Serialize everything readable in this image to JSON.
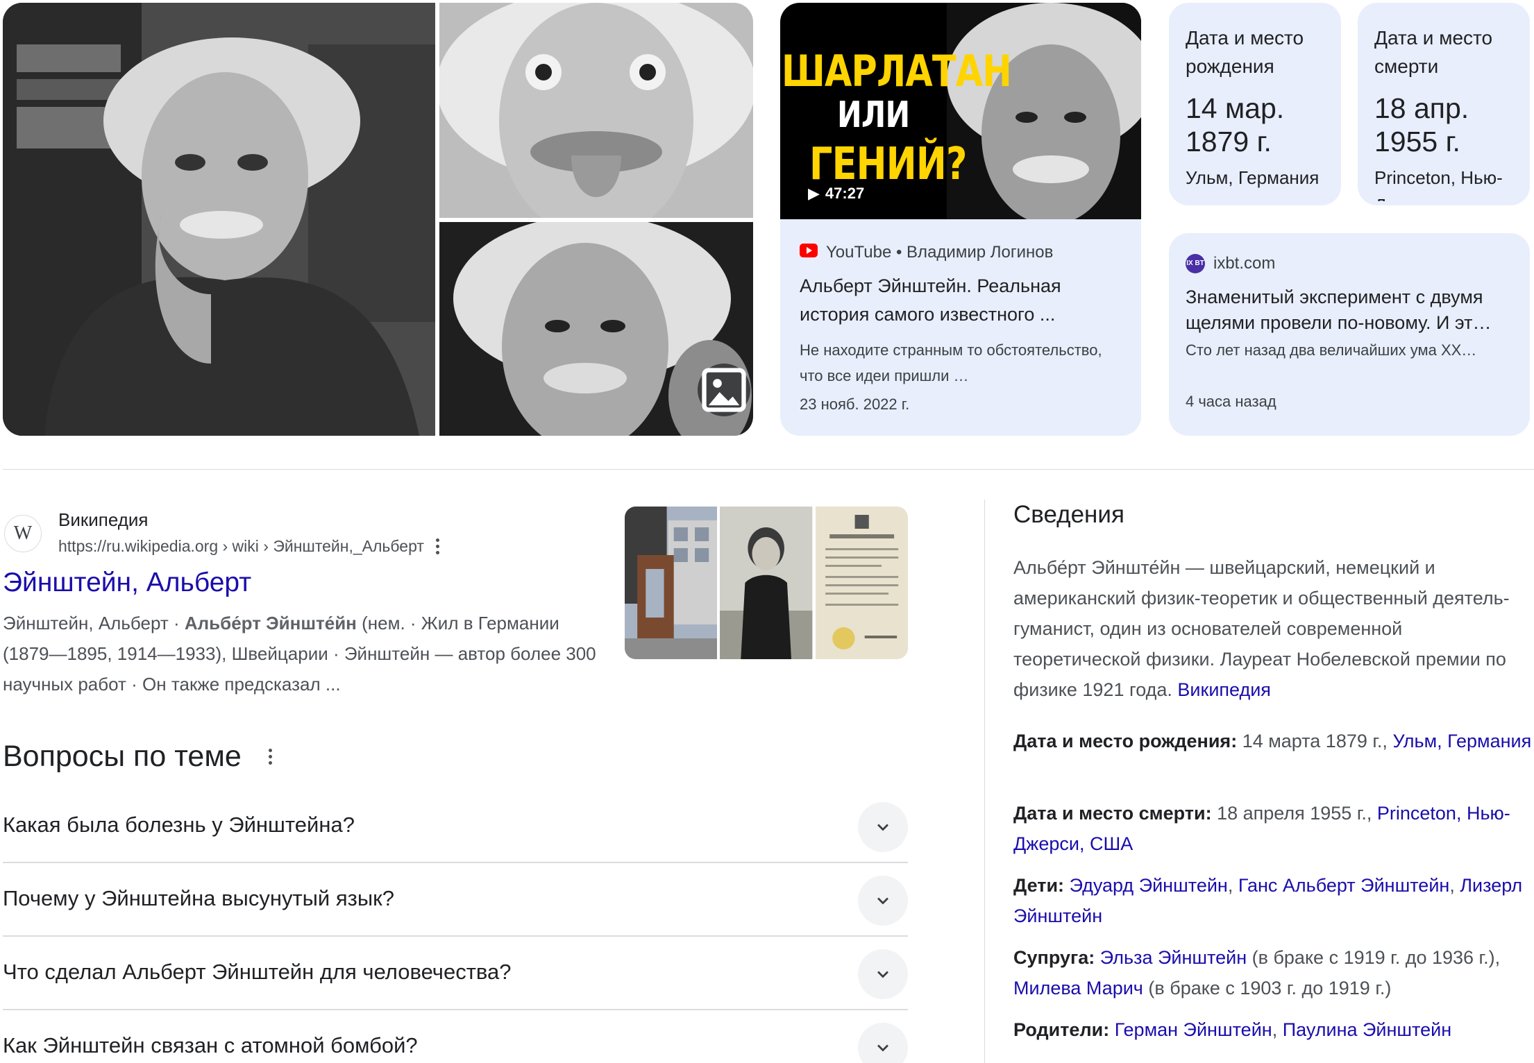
{
  "video": {
    "thumb_line1": "ШАРЛАТАН",
    "thumb_line2": "ИЛИ",
    "thumb_line3": "ГЕНИЙ?",
    "duration": "47:27",
    "source": "YouTube • Владимир Логинов",
    "title": "Альберт Эйнштейн. Реальная история самого известного ...",
    "snippet": "Не находите странным то обстоятельство, что все идеи пришли …",
    "date": "23 нояб. 2022 г."
  },
  "birth_tile": {
    "label": "Дата и место рождения",
    "value": "14 мар. 1879 г.",
    "place": "Ульм, Германия"
  },
  "death_tile": {
    "label": "Дата и место смерти",
    "value": "18 апр. 1955 г.",
    "place": "Princeton, Нью-Джерси"
  },
  "news": {
    "favicon_text": "IX BT",
    "source": "ixbt.com",
    "title": "Знаменитый эксперимент с двумя щелями провели по-новому. И эт…",
    "snippet": "Сто лет назад два величайших ума XX…",
    "date": "4 часа назад"
  },
  "wiki": {
    "favicon": "W",
    "site": "Википедия",
    "url": "https://ru.wikipedia.org › wiki › Эйнштейн,_Альберт",
    "title": "Эйнштейн, Альберт",
    "snippet_1": "Эйнштейн, Альберт · ",
    "snippet_bold": "Альбе́рт Эйнште́йн",
    "snippet_2": " (нем. · Жил в Германии (1879—1895, 1914—1933), Швейцарии · Эйнштейн — автор более 300 научных работ · Он также предсказал ..."
  },
  "paa": {
    "heading": "Вопросы по теме",
    "questions": [
      "Какая была болезнь у Эйнштейна?",
      "Почему у Эйнштейна высунутый язык?",
      "Что сделал Альберт Эйнштейн для человечества?",
      "Как Эйнштейн связан с атомной бомбой?"
    ]
  },
  "kp": {
    "heading": "Сведения",
    "description": "Альбе́рт Эйнште́йн — швейцарский, немецкий и американский физик-теоретик и общественный деятель-гуманист, один из основателей современной теоретической физики. Лауреат Нобелевской премии по физике 1921 года. ",
    "desc_link": "Википедия",
    "birth_label": "Дата и место рождения:",
    "birth_text": " 14 марта 1879 г., ",
    "birth_link": "Ульм, Германия",
    "death_label": "Дата и место смерти:",
    "death_text": " 18 апреля 1955 г., ",
    "death_link": "Princeton, Нью-Джерси, США",
    "children_label": "Дети:",
    "child_1": "Эдуард Эйнштейн",
    "child_2": "Ганс Альберт Эйнштейн",
    "child_3": "Лизерл Эйнштейн",
    "sep": ", ",
    "spouse_label": "Супруга:",
    "spouse_1": "Эльза Эйнштейн",
    "spouse_1_note": " (в браке с 1919 г. до 1936 г.), ",
    "spouse_2": "Милева Марич",
    "spouse_2_note": " (в браке с 1903 г. до 1919 г.)",
    "parents_label": "Родители:",
    "parent_1": "Герман Эйнштейн",
    "parent_2": "Паулина Эйнштейн"
  },
  "colors": {
    "link": "#1a0dab",
    "card_bg": "#e8eefb",
    "divider": "#dadce0",
    "youtube_red": "#ff0000",
    "thumb_yellow": "#ffd400"
  },
  "icons": [
    "image-search-icon",
    "play-icon",
    "youtube-icon",
    "more-vert-icon",
    "chevron-down-icon"
  ]
}
